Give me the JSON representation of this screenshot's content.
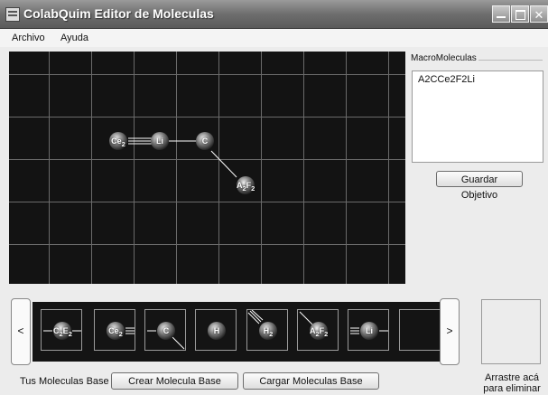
{
  "window": {
    "title": "ColabQuim Editor de Moleculas",
    "minimize_glyph": "",
    "maximize_glyph": "",
    "close_glyph": "✕"
  },
  "menu": {
    "items": [
      "Archivo",
      "Ayuda"
    ]
  },
  "canvas": {
    "atoms": [
      {
        "symbol": "Ce",
        "sub": "2"
      },
      {
        "symbol": "Li",
        "sub": ""
      },
      {
        "symbol": "C",
        "sub": ""
      },
      {
        "symbol": "A",
        "sub": "2",
        "symbol2": "F",
        "sub2": "2"
      }
    ],
    "bonds": [
      "Ce2-Li triple",
      "Li-C single",
      "C-A2F2 single"
    ]
  },
  "macro": {
    "legend": "MacroMoleculas",
    "items": [
      "A2CCe2F2Li"
    ],
    "save_button": "Guardar Objetivo"
  },
  "strip": {
    "left_arrow": "<",
    "right_arrow": ">",
    "molecules": [
      {
        "symbol": "C",
        "sub": "2",
        "symbol2": "E",
        "sub2": "2",
        "bonds": "left-single, right-single"
      },
      {
        "symbol": "Ce",
        "sub": "2",
        "symbol2": "",
        "sub2": "",
        "bonds": "right-triple"
      },
      {
        "symbol": "C",
        "sub": "",
        "symbol2": "",
        "sub2": "",
        "bonds": "left-single, bottom-right-single"
      },
      {
        "symbol": "H",
        "sub": "",
        "symbol2": "",
        "sub2": "",
        "bonds": "none"
      },
      {
        "symbol": "H",
        "sub": "2",
        "symbol2": "",
        "sub2": "",
        "bonds": "top-left-triple"
      },
      {
        "symbol": "A",
        "sub": "2",
        "symbol2": "F",
        "sub2": "2",
        "bonds": "top-left-single"
      },
      {
        "symbol": "Li",
        "sub": "",
        "symbol2": "",
        "sub2": "",
        "bonds": "left-triple, right-single"
      },
      {
        "symbol": "",
        "sub": "",
        "symbol2": "",
        "sub2": "",
        "bonds": "empty slot"
      }
    ]
  },
  "footer": {
    "base_label": "Tus Moleculas Base",
    "create_button": "Crear Molecula Base",
    "load_button": "Cargar Moleculas Base",
    "trash_line1": "Arrastre acá",
    "trash_line2": "para eliminar"
  }
}
